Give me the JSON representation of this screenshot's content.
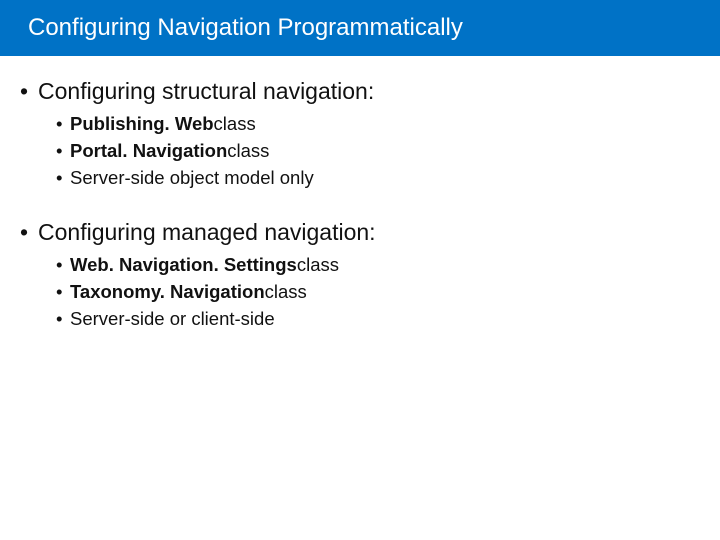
{
  "title": "Configuring Navigation Programmatically",
  "section1": {
    "heading": "Configuring structural navigation:",
    "items": [
      {
        "bold": "Publishing. Web",
        "rest": "class"
      },
      {
        "bold": "Portal. Navigation",
        "rest": "class"
      },
      {
        "bold": "",
        "rest": "Server-side object model only"
      }
    ]
  },
  "section2": {
    "heading": "Configuring managed navigation:",
    "items": [
      {
        "bold": "Web. Navigation. Settings",
        "rest": "class"
      },
      {
        "bold": "Taxonomy. Navigation",
        "rest": "class"
      },
      {
        "bold": "",
        "rest": "Server-side or client-side"
      }
    ]
  },
  "bullet": "•"
}
